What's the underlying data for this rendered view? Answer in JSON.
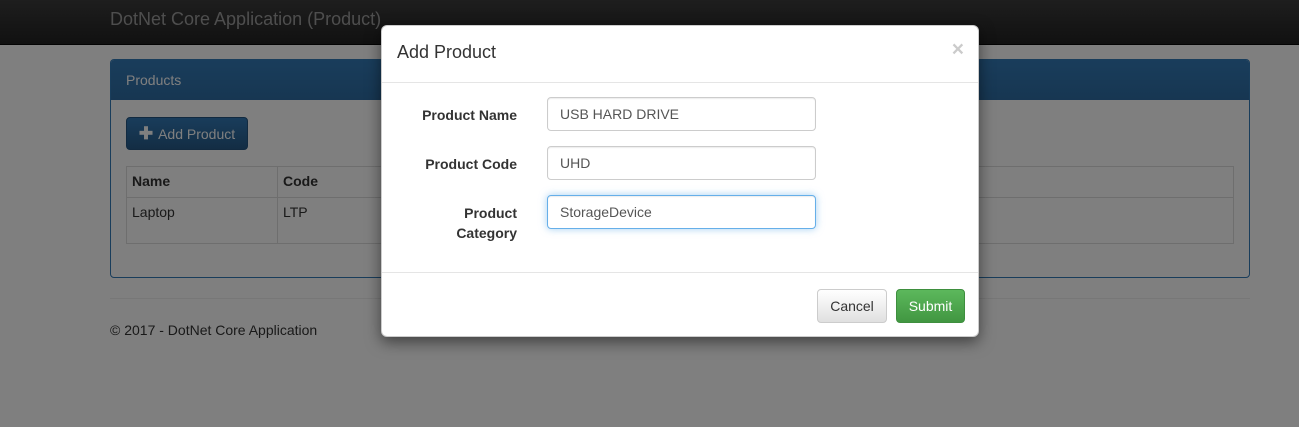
{
  "app": {
    "title": "DotNet Core Application (Product)"
  },
  "panel": {
    "heading": "Products",
    "add_button_label": "Add Product",
    "add_button_icon": "plus-icon"
  },
  "table": {
    "headers": [
      "Name",
      "Code"
    ],
    "rows": [
      [
        "Laptop",
        "LTP"
      ]
    ]
  },
  "footer": {
    "text": "© 2017 - DotNet Core Application"
  },
  "modal": {
    "title": "Add Product",
    "close_symbol": "×",
    "fields": {
      "name": {
        "label": "Product Name",
        "value": "USB HARD DRIVE"
      },
      "code": {
        "label": "Product Code",
        "value": "UHD"
      },
      "category": {
        "label_line1": "Product",
        "label_line2": "Category",
        "value": "StorageDevice"
      }
    },
    "cancel_label": "Cancel",
    "submit_label": "Submit"
  },
  "colors": {
    "primary": "#337ab7",
    "success": "#5cb85c",
    "navbar": "#222222",
    "focus": "#66afe9"
  }
}
